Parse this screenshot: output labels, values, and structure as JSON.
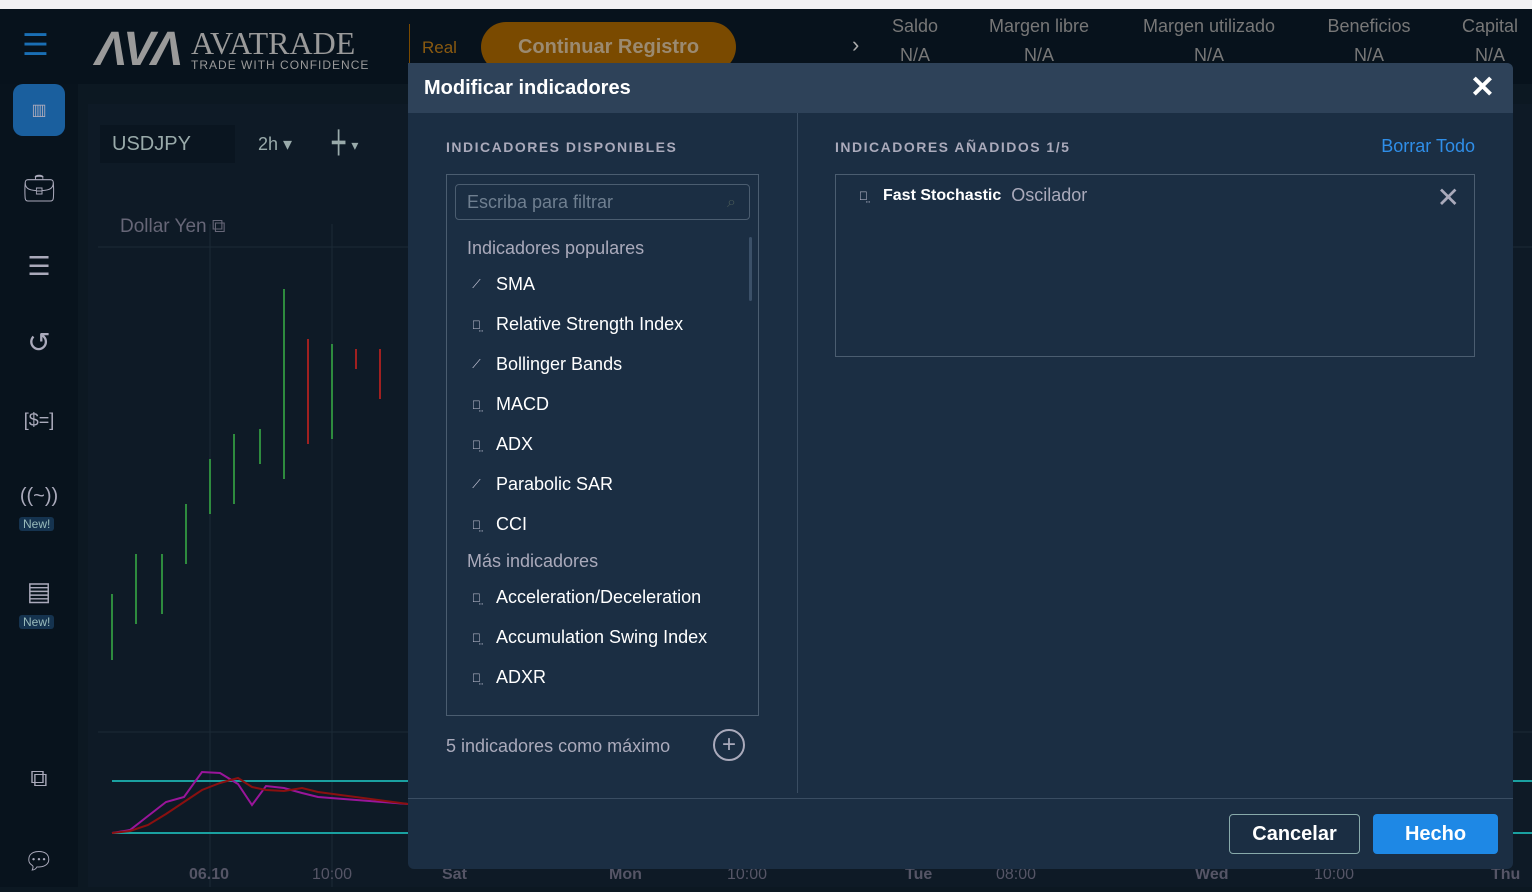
{
  "header": {
    "brand": "AVATRADE",
    "logo_mark": "AVA",
    "tagline": "TRADE WITH CONFIDENCE",
    "account_type": "Real",
    "continue_button": "Continuar Registro",
    "stats": [
      {
        "label": "Saldo",
        "value": "N/A"
      },
      {
        "label": "Margen libre",
        "value": "N/A"
      },
      {
        "label": "Margen utilizado",
        "value": "N/A"
      },
      {
        "label": "Beneficios",
        "value": "N/A"
      },
      {
        "label": "Capital",
        "value": "N/A"
      }
    ]
  },
  "sidebar": {
    "new_badge": "New!"
  },
  "chart": {
    "symbol": "USDJPY",
    "timeframe": "2h",
    "title": "Dollar Yen",
    "x_ticks": [
      "06.10",
      "10:00",
      "Sat",
      "Mon",
      "10:00",
      "Tue",
      "08:00",
      "Wed",
      "10:00",
      "Thu"
    ]
  },
  "modal": {
    "title": "Modificar indicadores",
    "available_title": "INDICADORES DISPONIBLES",
    "filter_placeholder": "Escriba para filtrar",
    "popular_group": "Indicadores populares",
    "popular": [
      {
        "label": "SMA",
        "icon": "trend"
      },
      {
        "label": "Relative Strength Index",
        "icon": "oscillator"
      },
      {
        "label": "Bollinger Bands",
        "icon": "trend"
      },
      {
        "label": "MACD",
        "icon": "oscillator"
      },
      {
        "label": "ADX",
        "icon": "oscillator"
      },
      {
        "label": "Parabolic SAR",
        "icon": "trend"
      },
      {
        "label": "CCI",
        "icon": "oscillator"
      }
    ],
    "more_group": "Más indicadores",
    "more": [
      {
        "label": "Acceleration/Deceleration",
        "icon": "oscillator"
      },
      {
        "label": "Accumulation Swing Index",
        "icon": "oscillator"
      },
      {
        "label": "ADXR",
        "icon": "oscillator"
      }
    ],
    "max_note": "5 indicadores como máximo",
    "added_title": "INDICADORES AÑADIDOS 1/5",
    "clear_all": "Borrar Todo",
    "added": [
      {
        "name": "Fast Stochastic",
        "type": "Oscilador"
      }
    ],
    "cancel": "Cancelar",
    "done": "Hecho"
  }
}
